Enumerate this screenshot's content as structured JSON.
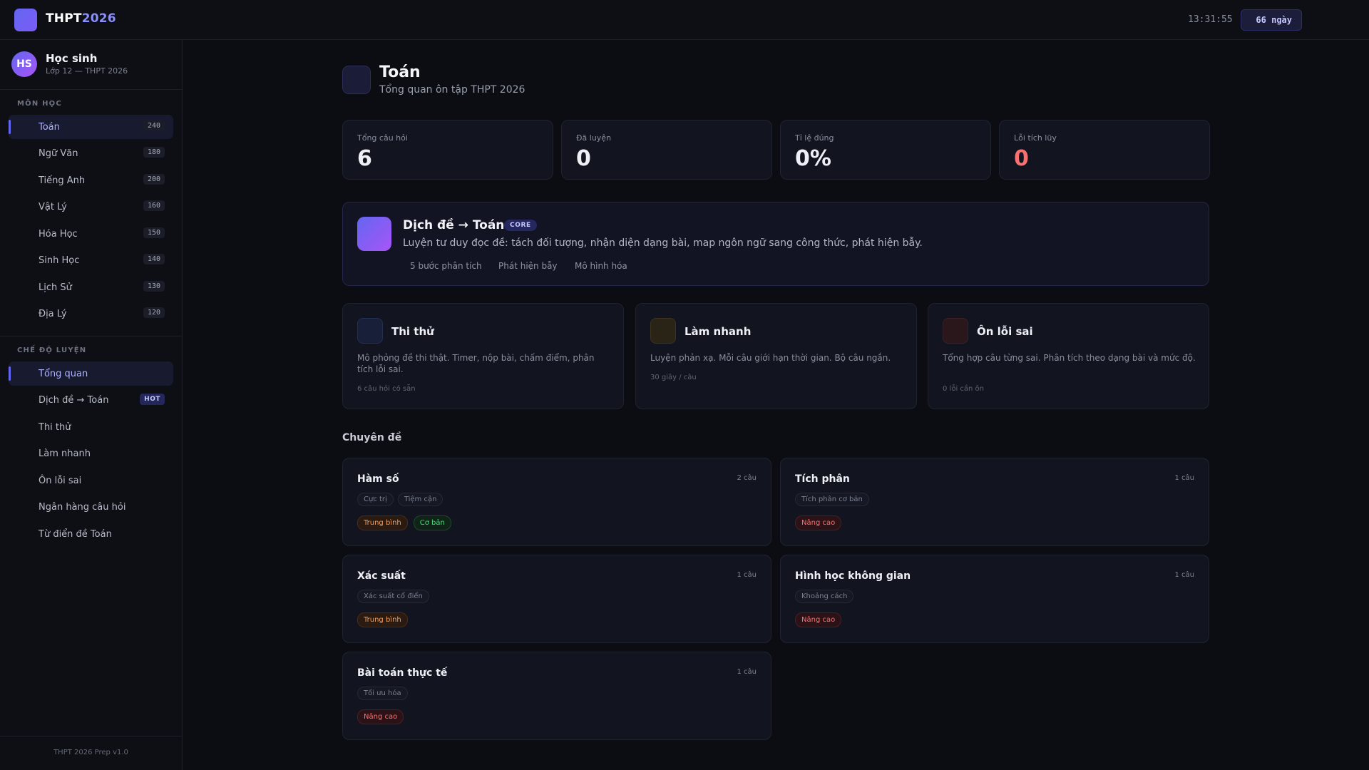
{
  "header": {
    "brand_part1": "THPT",
    "brand_part2": "2026",
    "clock": "13:31:55",
    "countdown": "66 ngày",
    "accent": "#6366f1"
  },
  "profile": {
    "avatar": "HS",
    "name": "Học sinh",
    "subtitle": "Lớp 12 — THPT 2026"
  },
  "sidebar": {
    "subjects_label": "MÔN HỌC",
    "subjects": [
      {
        "label": "Toán",
        "count": "240"
      },
      {
        "label": "Ngữ Văn",
        "count": "180"
      },
      {
        "label": "Tiếng Anh",
        "count": "200"
      },
      {
        "label": "Vật Lý",
        "count": "160"
      },
      {
        "label": "Hóa Học",
        "count": "150"
      },
      {
        "label": "Sinh Học",
        "count": "140"
      },
      {
        "label": "Lịch Sử",
        "count": "130"
      },
      {
        "label": "Địa Lý",
        "count": "120"
      }
    ],
    "modes_label": "CHẾ ĐỘ LUYỆN",
    "modes": [
      {
        "label": "Tổng quan"
      },
      {
        "label": "Dịch đề → Toán",
        "badge": "HOT"
      },
      {
        "label": "Thi thử"
      },
      {
        "label": "Làm nhanh"
      },
      {
        "label": "Ôn lỗi sai"
      },
      {
        "label": "Ngân hàng câu hỏi"
      },
      {
        "label": "Từ điển đề Toán"
      }
    ],
    "version": "THPT 2026 Prep v1.0"
  },
  "main": {
    "title": "Toán",
    "subtitle": "Tổng quan ôn tập THPT 2026",
    "stats": [
      {
        "label": "Tổng câu hỏi",
        "value": "6"
      },
      {
        "label": "Đã luyện",
        "value": "0"
      },
      {
        "label": "Tỉ lệ đúng",
        "value": "0%"
      },
      {
        "label": "Lỗi tích lũy",
        "value": "0"
      }
    ],
    "feature": {
      "title": "Dịch đề → Toán",
      "badge": "CORE",
      "desc": "Luyện tư duy đọc đề: tách đối tượng, nhận diện dạng bài, map ngôn ngữ sang công thức, phát hiện bẫy.",
      "chips": [
        "5 bước phân tích",
        "Phát hiện bẫy",
        "Mô hình hóa"
      ]
    },
    "modes": [
      {
        "title": "Thi thử",
        "desc": "Mô phỏng đề thi thật. Timer, nộp bài, chấm điểm, phân tích lỗi sai.",
        "meta": "6 câu hỏi có sẵn"
      },
      {
        "title": "Làm nhanh",
        "desc": "Luyện phản xạ. Mỗi câu giới hạn thời gian. Bộ câu ngắn.",
        "meta": "30 giây / câu"
      },
      {
        "title": "Ôn lỗi sai",
        "desc": "Tổng hợp câu từng sai. Phân tích theo dạng bài và mức độ.",
        "meta": "0 lỗi cần ôn"
      }
    ],
    "topics_heading": "Chuyên đề",
    "topics": [
      {
        "title": "Hàm số",
        "count": "2 câu",
        "tags": [
          "Cực trị",
          "Tiệm cận"
        ],
        "levels": [
          "Trung bình",
          "Cơ bản"
        ]
      },
      {
        "title": "Tích phân",
        "count": "1 câu",
        "tags": [
          "Tích phân cơ bản"
        ],
        "levels": [
          "Nâng cao"
        ]
      },
      {
        "title": "Xác suất",
        "count": "1 câu",
        "tags": [
          "Xác suất cổ điển"
        ],
        "levels": [
          "Trung bình"
        ]
      },
      {
        "title": "Hình học không gian",
        "count": "1 câu",
        "tags": [
          "Khoảng cách"
        ],
        "levels": [
          "Nâng cao"
        ]
      },
      {
        "title": "Bài toán thực tế",
        "count": "1 câu",
        "tags": [
          "Tối ưu hóa"
        ],
        "levels": [
          "Nâng cao"
        ]
      }
    ]
  }
}
